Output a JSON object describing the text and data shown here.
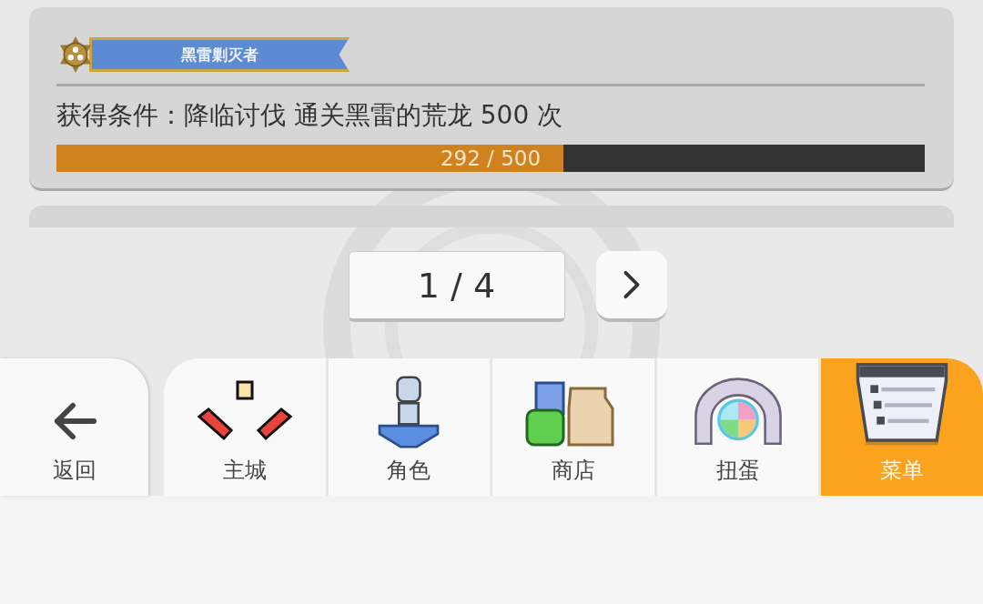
{
  "achievement": {
    "title": "黑雷剿灭者",
    "condition": "获得条件：降临讨伐 通关黑雷的荒龙 500 次",
    "progress": {
      "level": 0.584,
      "reading": "292 / 500"
    }
  },
  "pager": {
    "page": "1 / 4"
  },
  "back": {
    "label": "返回"
  },
  "nav": [
    {
      "label": "主城",
      "selected": false,
      "kind": "city"
    },
    {
      "label": "角色",
      "selected": false,
      "kind": "character"
    },
    {
      "label": "商店",
      "selected": false,
      "kind": "shop"
    },
    {
      "label": "扭蛋",
      "selected": false,
      "kind": "gacha"
    },
    {
      "label": "菜单",
      "selected": true,
      "kind": "menu"
    }
  ]
}
